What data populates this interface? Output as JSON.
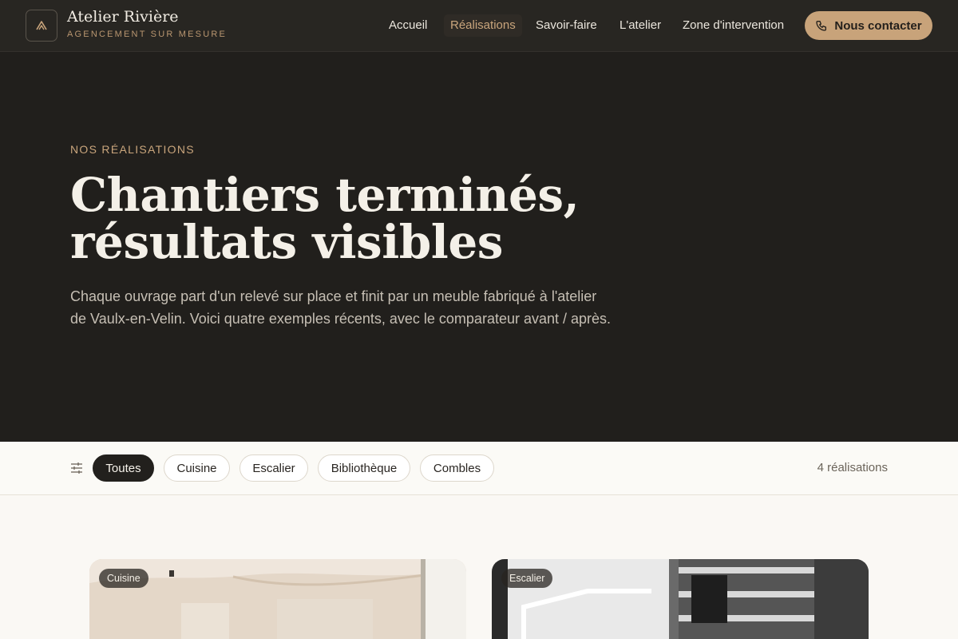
{
  "header": {
    "brand_name": "Atelier Rivière",
    "brand_tagline": "AGENCEMENT SUR MESURE",
    "logo_icon": "monogram-a-icon",
    "nav": [
      {
        "label": "Accueil",
        "active": false
      },
      {
        "label": "Réalisations",
        "active": true
      },
      {
        "label": "Savoir-faire",
        "active": false
      },
      {
        "label": "L'atelier",
        "active": false
      },
      {
        "label": "Zone d'intervention",
        "active": false
      }
    ],
    "cta_label": "Nous contacter",
    "cta_icon": "phone-icon"
  },
  "hero": {
    "eyebrow": "NOS RÉALISATIONS",
    "title_line1": "Chantiers terminés,",
    "title_line2": "résultats visibles",
    "description": "Chaque ouvrage part d'un relevé sur place et finit par un meuble fabriqué à l'atelier de Vaulx-en-Velin. Voici quatre exemples récents, avec le comparateur avant / après."
  },
  "filters": {
    "icon": "sliders-icon",
    "chips": [
      {
        "label": "Toutes",
        "active": true
      },
      {
        "label": "Cuisine",
        "active": false
      },
      {
        "label": "Escalier",
        "active": false
      },
      {
        "label": "Bibliothèque",
        "active": false
      },
      {
        "label": "Combles",
        "active": false
      }
    ],
    "count_text": "4 réalisations"
  },
  "projects": [
    {
      "category": "Cuisine"
    },
    {
      "category": "Escalier"
    }
  ],
  "colors": {
    "accent": "#c8a37a",
    "header_bg": "#282622",
    "hero_bg": "#211f1c",
    "page_bg": "#faf8f4"
  }
}
